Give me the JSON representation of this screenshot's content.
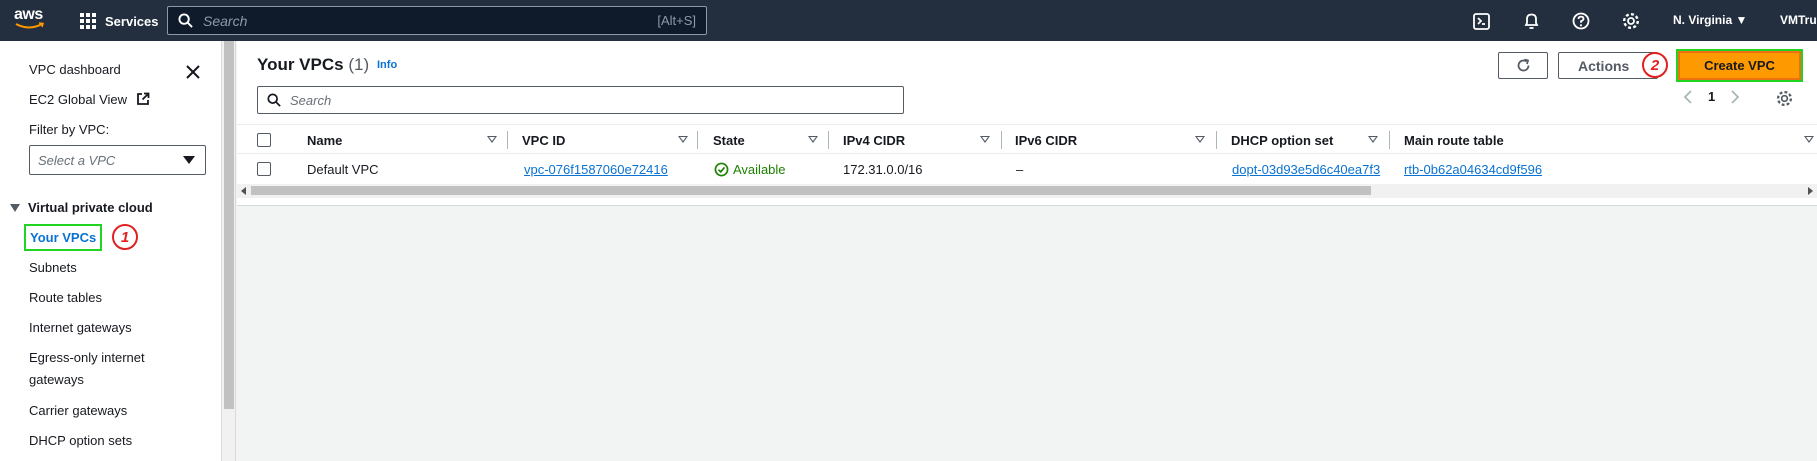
{
  "topnav": {
    "logo_text": "aws",
    "services_label": "Services",
    "search_placeholder": "Search",
    "search_shortcut": "[Alt+S]",
    "region": "N. Virginia ▼",
    "account": "VMTruc"
  },
  "sidebar": {
    "vpc_dashboard": "VPC dashboard",
    "ec2_global_view": "EC2 Global View",
    "filter_label": "Filter by VPC:",
    "filter_placeholder": "Select a VPC",
    "section_title": "Virtual private cloud",
    "items": [
      {
        "label": "Your VPCs"
      },
      {
        "label": "Subnets"
      },
      {
        "label": "Route tables"
      },
      {
        "label": "Internet gateways"
      },
      {
        "label": "Egress-only internet"
      },
      {
        "label": "gateways"
      },
      {
        "label": "Carrier gateways"
      },
      {
        "label": "DHCP option sets"
      }
    ]
  },
  "annotations": {
    "badge1": "1",
    "badge2": "2"
  },
  "main": {
    "title": "Your VPCs",
    "count": "(1)",
    "info": "Info",
    "actions_label": "Actions",
    "create_label": "Create VPC",
    "search_placeholder": "Search",
    "page_number": "1",
    "columns": [
      "Name",
      "VPC ID",
      "State",
      "IPv4 CIDR",
      "IPv6 CIDR",
      "DHCP option set",
      "Main route table"
    ],
    "rows": [
      {
        "name": "Default VPC",
        "vpc_id": "vpc-076f1587060e72416",
        "state": "Available",
        "ipv4": "172.31.0.0/16",
        "ipv6": "–",
        "dhcp": "dopt-03d93e5d6c40ea7f3",
        "route_table": "rtb-0b62a04634cd9f596"
      }
    ]
  },
  "colors": {
    "nav_bg": "#232f3e",
    "link": "#0972d3",
    "primary_btn": "#ff9900",
    "available": "#1d8102",
    "highlight": "#21d421",
    "badge": "#e02020"
  }
}
